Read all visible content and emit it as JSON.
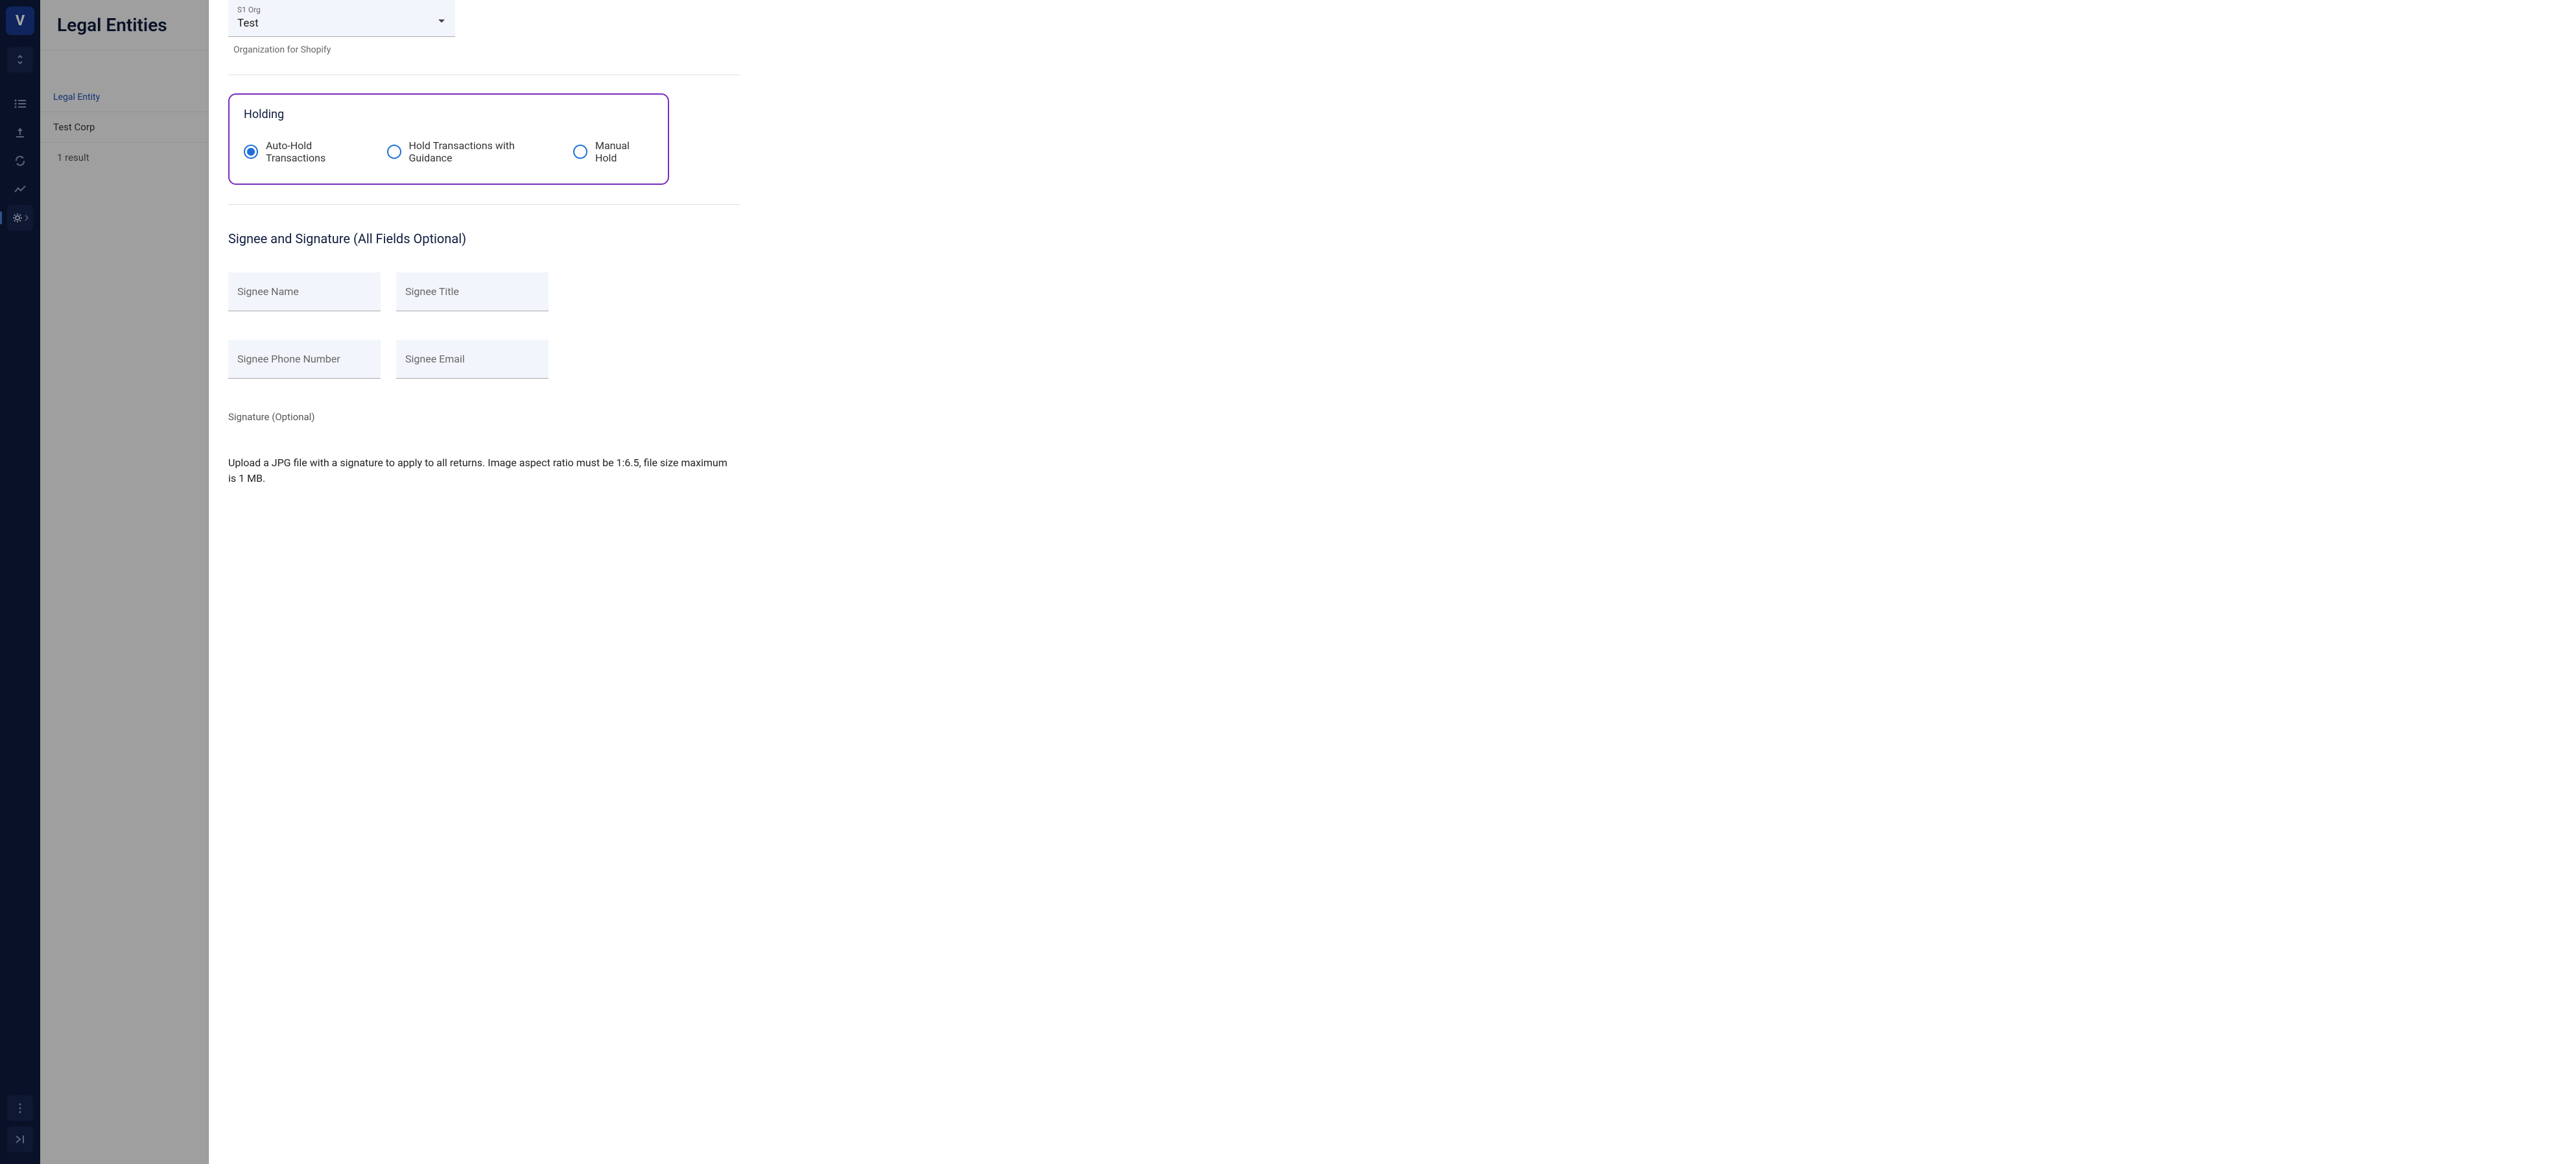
{
  "nav": {
    "logoText": "V"
  },
  "panel": {
    "title": "Legal Entities",
    "columnHeader": "Legal Entity",
    "rows": [
      "Test Corp"
    ],
    "resultCount": "1 result"
  },
  "form": {
    "orgDropdown": {
      "label": "S1 Org",
      "value": "Test",
      "helper": "Organization for Shopify"
    },
    "holding": {
      "title": "Holding",
      "options": [
        {
          "label": "Auto-Hold Transactions",
          "selected": true
        },
        {
          "label": "Hold Transactions with Guidance",
          "selected": false
        },
        {
          "label": "Manual Hold",
          "selected": false
        }
      ]
    },
    "signee": {
      "title": "Signee and Signature (All Fields Optional)",
      "fields": {
        "name": "Signee Name",
        "titleField": "Signee Title",
        "phone": "Signee Phone Number",
        "email": "Signee Email"
      },
      "signatureLabel": "Signature (Optional)",
      "uploadInstructions": "Upload a JPG file with a signature to apply to all returns. Image aspect ratio must be 1:6.5, file size maximum is 1 MB."
    }
  }
}
